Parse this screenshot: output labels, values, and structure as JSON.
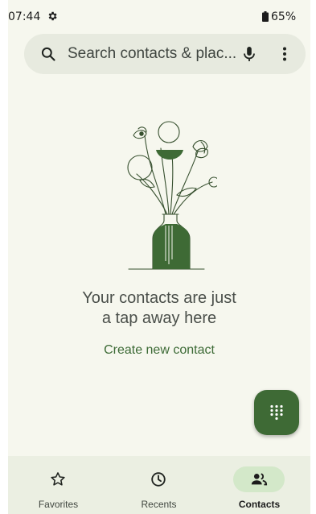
{
  "status_bar": {
    "time": "07:44",
    "battery": "65%",
    "icons": [
      "gear-icon",
      "battery-icon"
    ]
  },
  "search": {
    "placeholder": "Search contacts & plac...",
    "icons": [
      "search-icon",
      "mic-icon",
      "more-vert-icon"
    ]
  },
  "empty_state": {
    "line1": "Your contacts are just",
    "line2": "a tap away here",
    "action": "Create new contact"
  },
  "fab": {
    "icon": "dialpad-icon",
    "color": "#3e6a35"
  },
  "bottom_nav": {
    "items": [
      {
        "label": "Favorites",
        "icon": "star-outline-icon",
        "active": false
      },
      {
        "label": "Recents",
        "icon": "clock-icon",
        "active": false
      },
      {
        "label": "Contacts",
        "icon": "people-icon",
        "active": true
      }
    ]
  },
  "colors": {
    "accent": "#3e6a35",
    "background": "#f6f7ee",
    "search_bg": "#e7eadf",
    "nav_bg": "#ebefe2",
    "active_pill": "#d3e8c9"
  }
}
